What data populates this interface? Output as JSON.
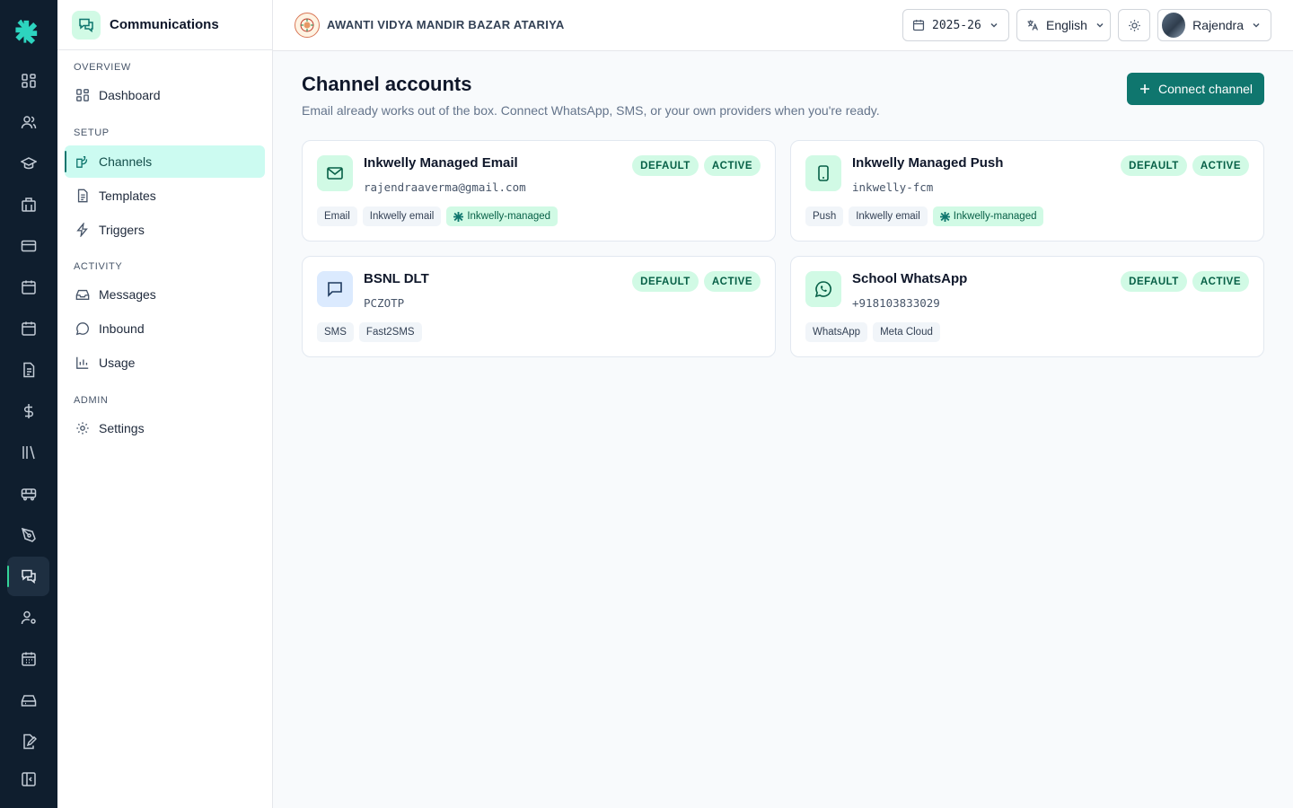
{
  "app": {
    "module_title": "Communications",
    "school_name": "AWANTI VIDYA MANDIR BAZAR ATARIYA"
  },
  "topbar": {
    "year": "2025-26",
    "language": "English",
    "user": "Rajendra"
  },
  "rail": {
    "icons": [
      "dashboard-icon",
      "people-icon",
      "graduation-cap-icon",
      "building-icon",
      "card-icon",
      "calendar-icon",
      "calendar-alt-icon",
      "document-icon",
      "dollar-icon",
      "library-icon",
      "bus-icon",
      "pen-tool-icon",
      "chat-icon",
      "user-settings-icon",
      "calendar-grid-icon",
      "storage-icon",
      "file-edit-icon",
      "collapse-icon"
    ],
    "active": "chat-icon"
  },
  "sidebar": {
    "sections": [
      {
        "label": "OVERVIEW",
        "items": [
          {
            "label": "Dashboard",
            "icon": "dashboard-icon"
          }
        ]
      },
      {
        "label": "SETUP",
        "items": [
          {
            "label": "Channels",
            "icon": "channels-icon",
            "active": true
          },
          {
            "label": "Templates",
            "icon": "document-icon"
          },
          {
            "label": "Triggers",
            "icon": "bolt-icon"
          }
        ]
      },
      {
        "label": "ACTIVITY",
        "items": [
          {
            "label": "Messages",
            "icon": "inbox-icon"
          },
          {
            "label": "Inbound",
            "icon": "chat-bubble-icon"
          },
          {
            "label": "Usage",
            "icon": "bar-chart-icon"
          }
        ]
      },
      {
        "label": "ADMIN",
        "items": [
          {
            "label": "Settings",
            "icon": "gear-icon"
          }
        ]
      }
    ]
  },
  "main": {
    "title": "Channel accounts",
    "subtitle": "Email already works out of the box. Connect WhatsApp, SMS, or your own providers when you're ready.",
    "connect_label": "Connect channel",
    "cards": [
      {
        "title": "Inkwelly Managed Email",
        "address": "rajendraaverma@gmail.com",
        "icon": "mail-icon",
        "badges": [
          "DEFAULT",
          "ACTIVE"
        ],
        "tags": [
          "Email",
          "Inkwelly email"
        ],
        "managed_tag": "Inkwelly-managed"
      },
      {
        "title": "Inkwelly Managed Push",
        "address": "inkwelly-fcm",
        "icon": "phone-icon",
        "badges": [
          "DEFAULT",
          "ACTIVE"
        ],
        "tags": [
          "Push",
          "Inkwelly email"
        ],
        "managed_tag": "Inkwelly-managed"
      },
      {
        "title": "BSNL DLT",
        "address": "PCZOTP",
        "icon": "message-square-icon",
        "badges": [
          "DEFAULT",
          "ACTIVE"
        ],
        "tags": [
          "SMS",
          "Fast2SMS"
        ]
      },
      {
        "title": "School WhatsApp",
        "address": "+918103833029",
        "icon": "whatsapp-icon",
        "badges": [
          "DEFAULT",
          "ACTIVE"
        ],
        "tags": [
          "WhatsApp",
          "Meta Cloud"
        ]
      }
    ]
  },
  "colors": {
    "rail_bg": "#0f1e2e",
    "accent": "#0f766e",
    "badge_bg": "#d1fae5",
    "active_nav_bg": "#ccfbf1"
  }
}
